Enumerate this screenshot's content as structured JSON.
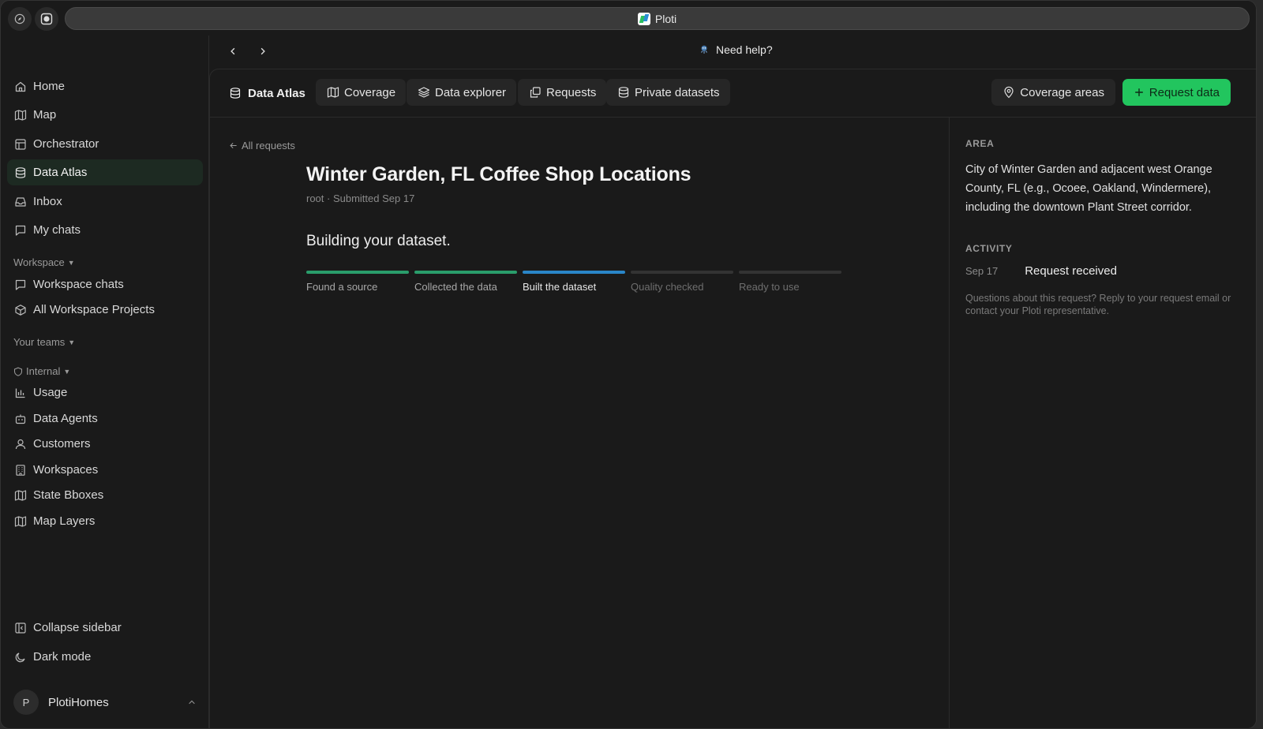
{
  "browser": {
    "tab_title": "Ploti"
  },
  "header": {
    "help_label": "Need help?"
  },
  "sidebar": {
    "items": [
      {
        "label": "Home",
        "icon": "home-icon"
      },
      {
        "label": "Map",
        "icon": "map-icon"
      },
      {
        "label": "Orchestrator",
        "icon": "layout-icon"
      },
      {
        "label": "Data Atlas",
        "icon": "database-icon",
        "active": true
      },
      {
        "label": "Inbox",
        "icon": "inbox-icon"
      },
      {
        "label": "My chats",
        "icon": "chat-icon"
      }
    ],
    "workspace_label": "Workspace",
    "workspace_items": [
      {
        "label": "Workspace chats",
        "icon": "chat-icon"
      },
      {
        "label": "All Workspace Projects",
        "icon": "cube-icon"
      }
    ],
    "teams_label": "Your teams",
    "internal_label": "Internal",
    "internal_items": [
      {
        "label": "Usage",
        "icon": "bar-chart-icon"
      },
      {
        "label": "Data Agents",
        "icon": "bot-icon"
      },
      {
        "label": "Customers",
        "icon": "user-icon"
      },
      {
        "label": "Workspaces",
        "icon": "building-icon"
      },
      {
        "label": "State Bboxes",
        "icon": "map-icon"
      },
      {
        "label": "Map Layers",
        "icon": "map-icon"
      }
    ],
    "collapse_label": "Collapse sidebar",
    "dark_mode_label": "Dark mode",
    "user": {
      "initial": "P",
      "name": "PlotiHomes"
    }
  },
  "tabbar": {
    "brand": "Data Atlas",
    "tabs": [
      {
        "label": "Coverage",
        "icon": "map-icon"
      },
      {
        "label": "Data explorer",
        "icon": "layers-icon"
      },
      {
        "label": "Requests",
        "icon": "copy-icon"
      },
      {
        "label": "Private datasets",
        "icon": "database-icon"
      }
    ],
    "coverage_areas_label": "Coverage areas",
    "request_data_label": "Request data"
  },
  "request": {
    "back_label": "All requests",
    "title": "Winter Garden, FL Coffee Shop Locations",
    "meta": "root · Submitted Sep 17",
    "status": "Building your dataset.",
    "steps": [
      {
        "label": "Found a source",
        "state": "done"
      },
      {
        "label": "Collected the data",
        "state": "done"
      },
      {
        "label": "Built the dataset",
        "state": "current"
      },
      {
        "label": "Quality checked",
        "state": "pending"
      },
      {
        "label": "Ready to use",
        "state": "pending"
      }
    ]
  },
  "details": {
    "area_heading": "AREA",
    "area_text": "City of Winter Garden and adjacent west Orange County, FL (e.g., Ocoee, Oakland, Windermere), including the downtown Plant Street corridor.",
    "activity_heading": "ACTIVITY",
    "activity": [
      {
        "date": "Sep 17",
        "text": "Request received"
      }
    ],
    "note": "Questions about this request? Reply to your request email or contact your Ploti representative."
  },
  "colors": {
    "accent_green": "#22c55e",
    "progress_done": "#2a9d6b",
    "progress_current": "#2a86c8"
  }
}
